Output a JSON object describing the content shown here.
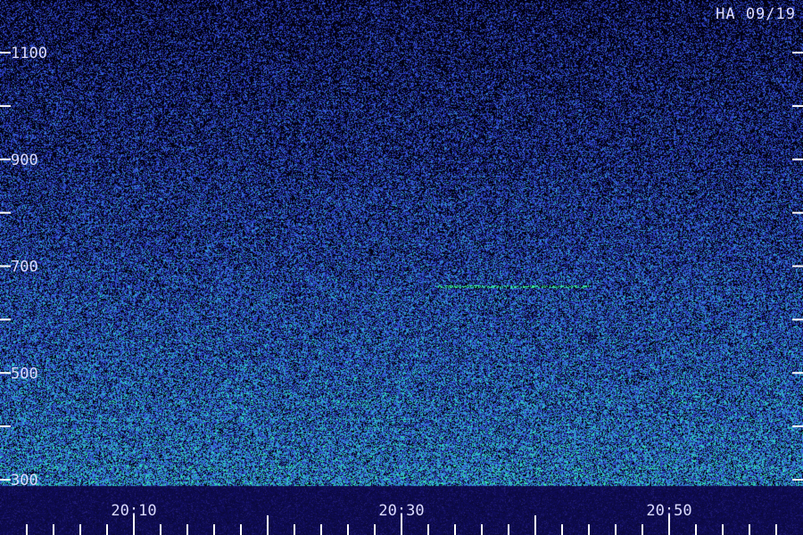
{
  "chart_data": {
    "type": "heatmap",
    "title": "",
    "stamp": "HA 09/19",
    "xlabel": "",
    "ylabel": "",
    "x_ticks": [
      {
        "value": "20:10",
        "minutes": 10
      },
      {
        "value": "20:30",
        "minutes": 30
      },
      {
        "value": "20:50",
        "minutes": 50
      }
    ],
    "x_range_minutes": [
      0,
      60
    ],
    "x_minor_step_minutes": 2,
    "y_labels": [
      300,
      500,
      700,
      900,
      1100
    ],
    "y_ticks": [
      300,
      400,
      500,
      600,
      700,
      800,
      900,
      1000,
      1100
    ],
    "y_range": [
      300,
      1200
    ],
    "features": [
      {
        "kind": "narrowband line",
        "y": 663,
        "x_start_minutes": 32.7,
        "x_end_minutes": 44.0
      }
    ],
    "colors": {
      "background": "#000000",
      "low": "#1a1aa0",
      "mid": "#3a5ad8",
      "high": "#28d8c8",
      "peak": "#40ff90",
      "bottom_band": "#100d5a",
      "text": "#dcdcff",
      "tick": "#ffffff"
    }
  }
}
